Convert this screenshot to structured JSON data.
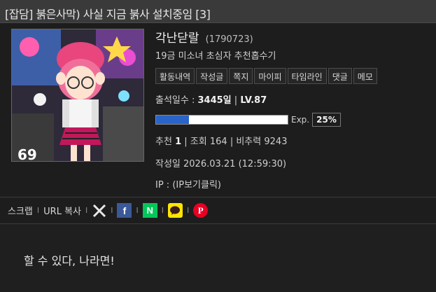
{
  "post": {
    "title": "[잡담] 붉은사막) 사실 지금 붉사 설치중임 [3]",
    "body": "할 수 있다, 나라면!"
  },
  "author": {
    "nickname": "각난닫랄",
    "uid": "(1790723)",
    "motto": "19금 미소녀 초심자 추천홉수기",
    "menu": [
      "활동내역",
      "작성글",
      "쪽지",
      "마이피",
      "타임라인",
      "댓글",
      "메모"
    ]
  },
  "attendance": {
    "label": "출석일수 :",
    "days": "3445일",
    "sep": "|",
    "level": "LV.87"
  },
  "exp": {
    "label": "Exp.",
    "percent_text": "25%",
    "fraction": 0.25
  },
  "stats": {
    "recommend_label": "추천",
    "recommend": "1",
    "view_label": "조회",
    "views": "164",
    "nonrec_label": "비추력",
    "nonrec": "9243"
  },
  "date": "작성일 2026.03.21 (12:59:30)",
  "ip": "IP : (IP보기클릭)",
  "share": {
    "scrap": "스크랩",
    "url_copy": "URL 복사",
    "sep": "I",
    "icons": [
      "x-icon",
      "facebook-icon",
      "naver-icon",
      "kakao-icon",
      "pinterest-icon"
    ]
  },
  "colors": {
    "background": "#1f1f1f",
    "titlebar": "#3a3a3a",
    "exp_fill": "#2a64c8",
    "facebook": "#3b5998",
    "naver": "#03c75a",
    "kakao": "#fee500",
    "pinterest": "#e60023"
  }
}
